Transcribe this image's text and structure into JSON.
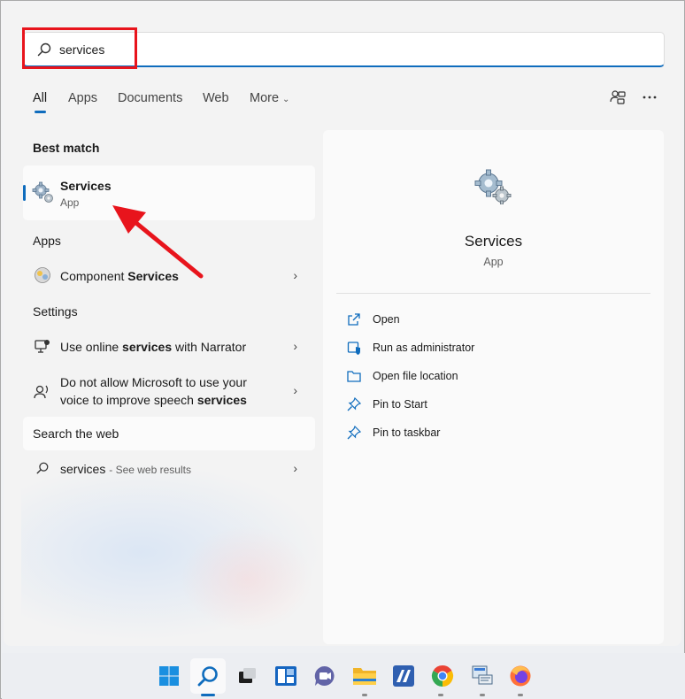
{
  "search": {
    "value": "services"
  },
  "tabs": [
    {
      "label": "All",
      "active": true
    },
    {
      "label": "Apps"
    },
    {
      "label": "Documents"
    },
    {
      "label": "Web"
    },
    {
      "label": "More"
    }
  ],
  "sections": {
    "best_match": "Best match",
    "apps": "Apps",
    "settings": "Settings",
    "search_web": "Search the web"
  },
  "best_match": {
    "title": "Services",
    "subtitle": "App",
    "icon": "gear-icon"
  },
  "apps": [
    {
      "prefix": "Component ",
      "highlight": "Services",
      "icon": "component-services-icon"
    }
  ],
  "settings": [
    {
      "prefix": "Use online ",
      "highlight": "services",
      "suffix": " with Narrator",
      "icon": "narrator-icon"
    },
    {
      "line1": "Do not allow Microsoft to use your",
      "line2_prefix": "voice to improve speech ",
      "line2_highlight": "services",
      "icon": "speech-icon"
    }
  ],
  "web": {
    "query": "services",
    "hint": "- See web results"
  },
  "detail": {
    "title": "Services",
    "subtitle": "App",
    "actions": [
      {
        "label": "Open",
        "icon": "open-external-icon"
      },
      {
        "label": "Run as administrator",
        "icon": "shield-icon"
      },
      {
        "label": "Open file location",
        "icon": "folder-icon"
      },
      {
        "label": "Pin to Start",
        "icon": "pin-icon"
      },
      {
        "label": "Pin to taskbar",
        "icon": "pin-icon"
      }
    ]
  },
  "colors": {
    "accent": "#0f6cbd",
    "annotation_red": "#e8141c"
  }
}
